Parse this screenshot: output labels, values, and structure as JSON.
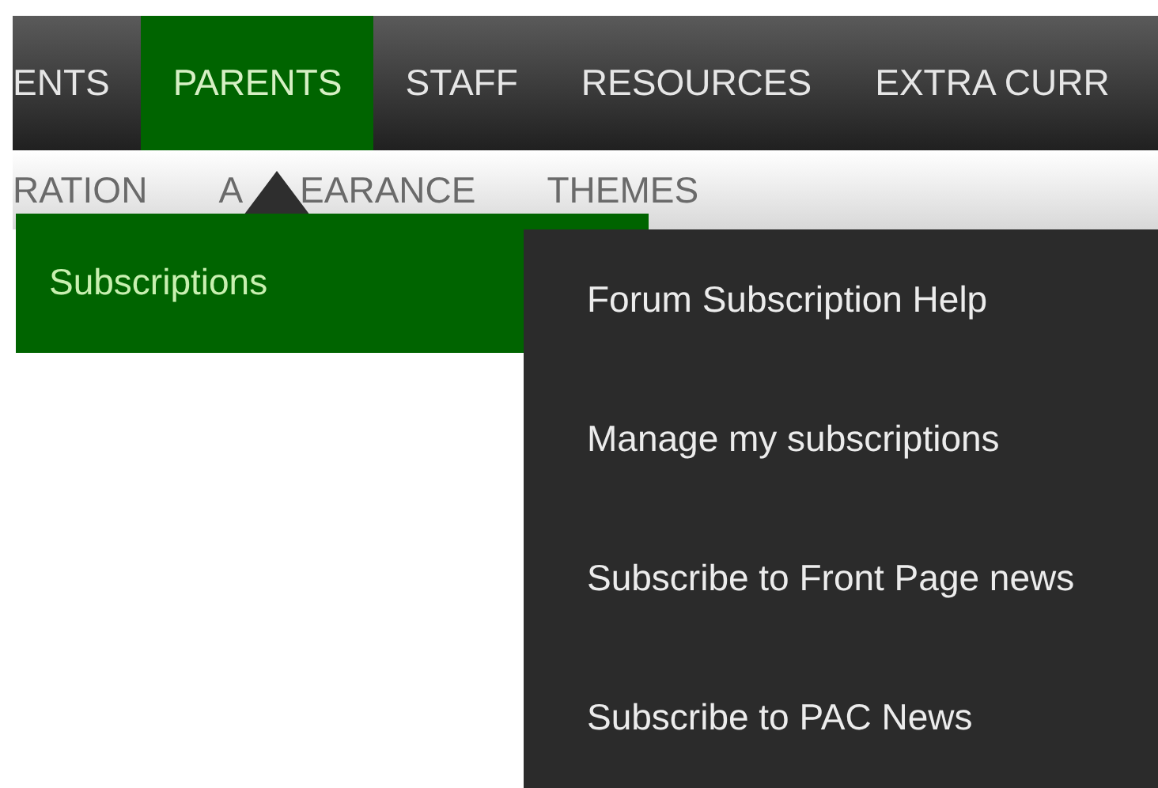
{
  "main_menu": {
    "items": [
      {
        "label": "ENTS",
        "selected": false
      },
      {
        "label": "PARENTS",
        "selected": true
      },
      {
        "label": "STAFF",
        "selected": false
      },
      {
        "label": "RESOURCES",
        "selected": false
      },
      {
        "label": "EXTRA CURR",
        "selected": false
      }
    ]
  },
  "sub_menu": {
    "items": [
      {
        "parts": [
          "RATION"
        ]
      },
      {
        "parts": [
          "A",
          "EARANCE"
        ]
      },
      {
        "parts": [
          "THEMES"
        ]
      }
    ]
  },
  "dropdown": {
    "items": [
      {
        "label": "Subscriptions"
      }
    ]
  },
  "flyout": {
    "items": [
      {
        "label": "Forum Subscription Help"
      },
      {
        "label": "Manage my subscriptions"
      },
      {
        "label": "Subscribe to Front Page news"
      },
      {
        "label": "Subscribe to PAC News"
      }
    ]
  }
}
